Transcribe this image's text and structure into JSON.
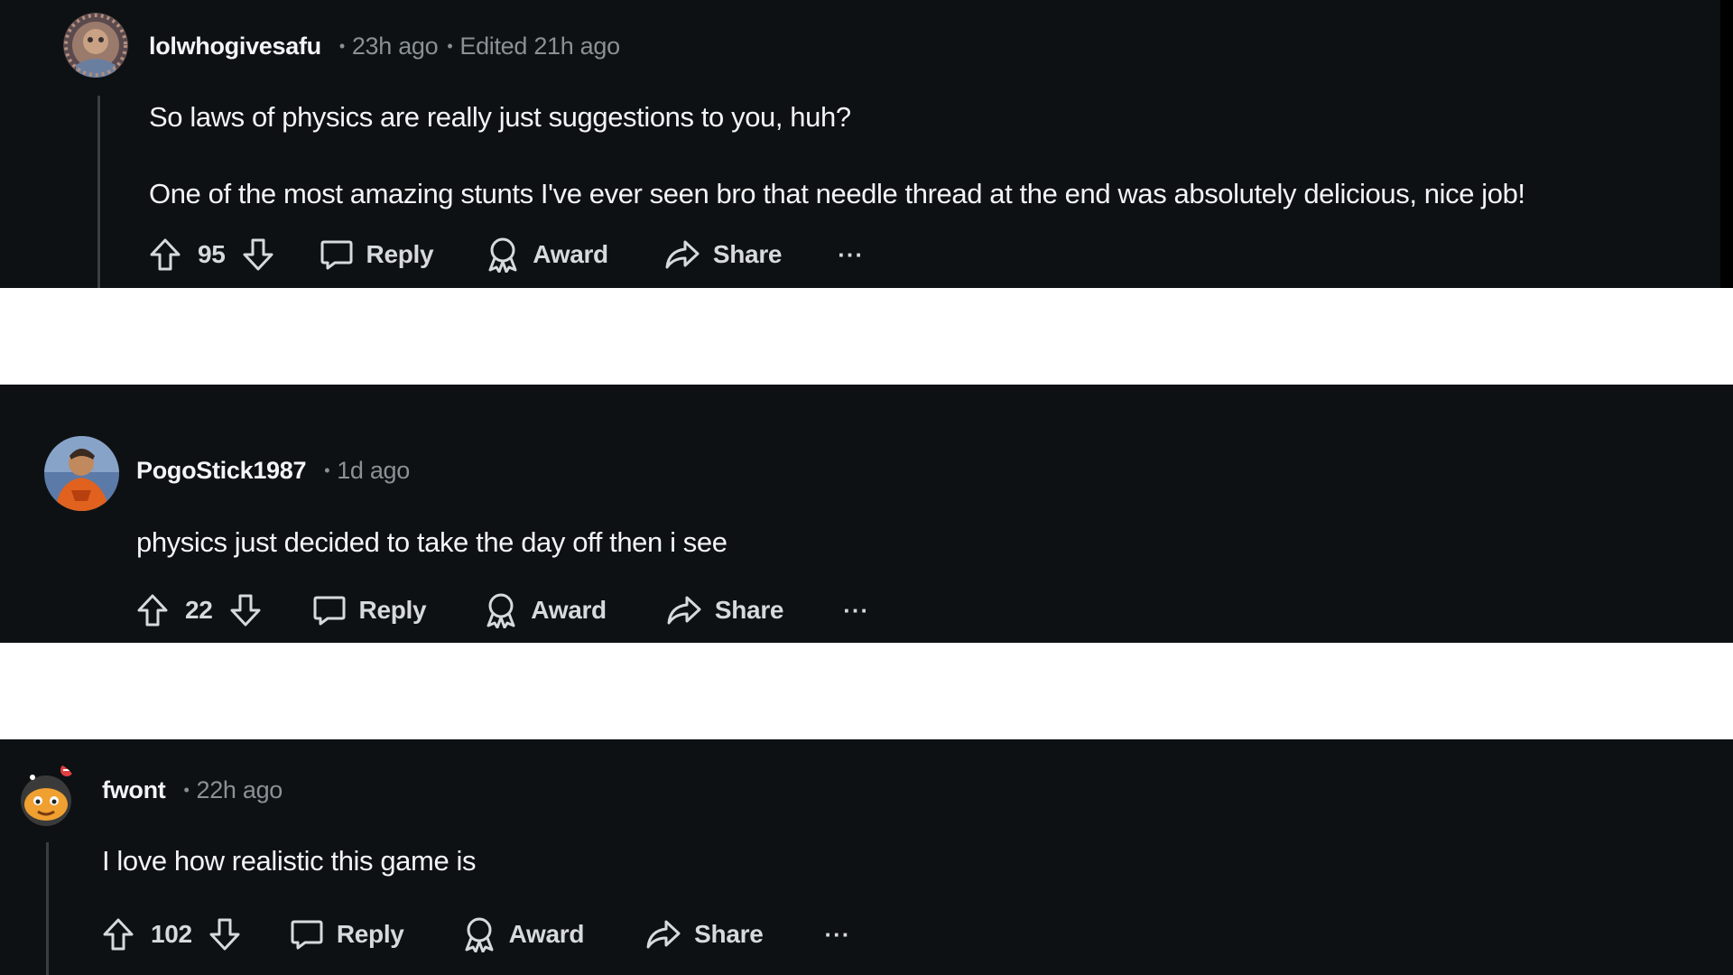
{
  "comments": [
    {
      "username": "lolwhogivesafu",
      "time": "23h ago",
      "edited": "Edited 21h ago",
      "paragraphs": [
        "So laws of physics are really just suggestions to you, huh?",
        "One of the most amazing stunts I've ever seen bro that needle thread at the end was absolutely delicious, nice job!"
      ],
      "score": "95"
    },
    {
      "username": "PogoStick1987",
      "time": "1d ago",
      "paragraphs": [
        "physics just decided to take the day off then i see"
      ],
      "score": "22"
    },
    {
      "username": "fwont",
      "time": "22h ago",
      "paragraphs": [
        "I love how realistic this game is"
      ],
      "score": "102"
    }
  ],
  "actions": {
    "reply": "Reply",
    "award": "Award",
    "share": "Share",
    "more": "···"
  },
  "icons": {
    "upvote": "arrow-up-outline",
    "downvote": "arrow-down-outline",
    "reply": "speech-bubble",
    "award": "award-ribbon",
    "share": "share-arrow"
  },
  "colors": {
    "background": "#0e1113",
    "text": "#f2f4f5",
    "muted": "#8a9196",
    "separator": "#ffffff"
  }
}
